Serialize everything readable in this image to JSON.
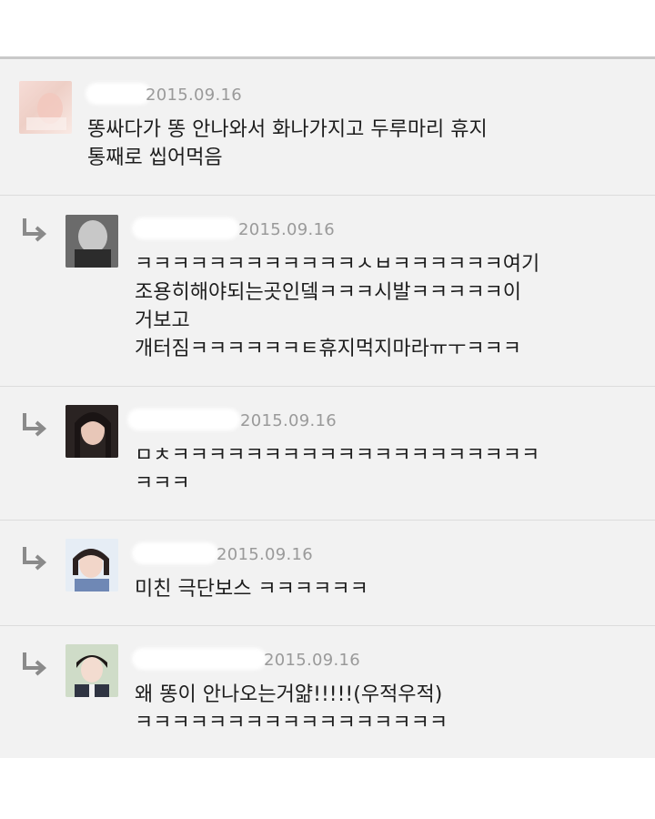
{
  "comments": [
    {
      "date": "2015.09.16",
      "lines": [
        "똥싸다가 똥 안나와서 화나가지고 두루마리 휴지",
        "통째로 씹어먹음"
      ]
    },
    {
      "date": "2015.09.16",
      "lines": [
        "ㅋㅋㅋㅋㅋㅋㅋㅋㅋㅋㅋㅋㅅㅂㅋㅋㅋㅋㅋㅋ여기",
        "조용히해야되는곳인뎈ㅋㅋㅋ시발ㅋㅋㅋㅋㅋ이",
        "거보고",
        "개터짐ㅋㅋㅋㅋㅋㅋㅌ휴지먹지마라ㅠㅜㅋㅋㅋ"
      ]
    },
    {
      "date": "2015.09.16",
      "lines": [
        "ㅁㅊㅋㅋㅋㅋㅋㅋㅋㅋㅋㅋㅋㅋㅋㅋㅋㅋㅋㅋㅋㅋ",
        "ㅋㅋㅋ"
      ]
    },
    {
      "date": "2015.09.16",
      "lines": [
        "미친 극단보스 ㅋㅋㅋㅋㅋㅋ"
      ]
    },
    {
      "date": "2015.09.16",
      "lines": [
        "왜 똥이 안나오는거얆!!!!!(우적우적)",
        "ㅋㅋㅋㅋㅋㅋㅋㅋㅋㅋㅋㅋㅋㅋㅋㅋㅋ"
      ]
    }
  ],
  "icons": {
    "reply": "reply-arrow-icon",
    "avatar": "user-avatar"
  },
  "colors": {
    "background": "#f2f2f2",
    "date": "#9a9a9a",
    "text": "#1d1d1d",
    "arrow": "#8a8a8a"
  }
}
